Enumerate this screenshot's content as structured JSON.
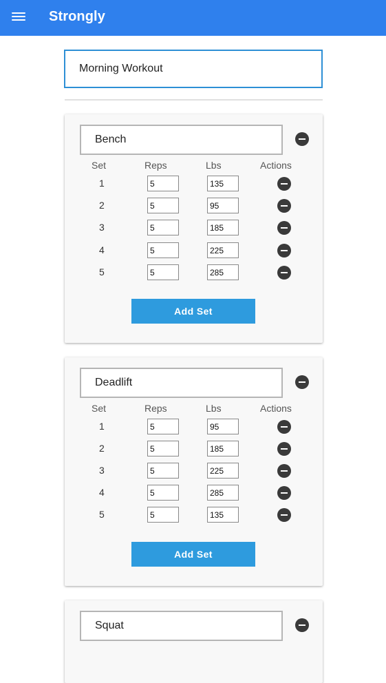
{
  "app": {
    "title": "Strongly"
  },
  "workout": {
    "name": "Morning Workout"
  },
  "table_headers": {
    "set": "Set",
    "reps": "Reps",
    "lbs": "Lbs",
    "actions": "Actions"
  },
  "add_set_label": "Add Set",
  "exercises": [
    {
      "name": "Bench",
      "sets": [
        {
          "set": "1",
          "reps": "5",
          "lbs": "135"
        },
        {
          "set": "2",
          "reps": "5",
          "lbs": "95"
        },
        {
          "set": "3",
          "reps": "5",
          "lbs": "185"
        },
        {
          "set": "4",
          "reps": "5",
          "lbs": "225"
        },
        {
          "set": "5",
          "reps": "5",
          "lbs": "285"
        }
      ]
    },
    {
      "name": "Deadlift",
      "sets": [
        {
          "set": "1",
          "reps": "5",
          "lbs": "95"
        },
        {
          "set": "2",
          "reps": "5",
          "lbs": "185"
        },
        {
          "set": "3",
          "reps": "5",
          "lbs": "225"
        },
        {
          "set": "4",
          "reps": "5",
          "lbs": "285"
        },
        {
          "set": "5",
          "reps": "5",
          "lbs": "135"
        }
      ]
    },
    {
      "name": "Squat",
      "sets": []
    }
  ],
  "icons": {
    "menu": "menu-icon",
    "remove": "minus-circle-icon"
  },
  "colors": {
    "appbar": "#2f80ed",
    "accent": "#2e9bde",
    "icon": "#3a3a3a"
  }
}
